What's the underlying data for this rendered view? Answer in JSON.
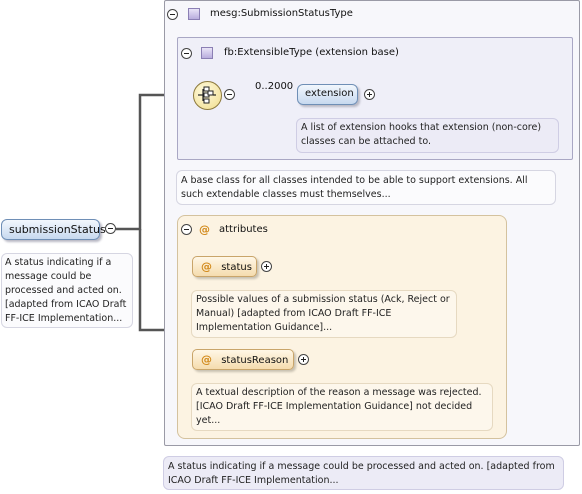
{
  "root": {
    "element_name": "submissionStatus",
    "doc": "A status indicating if a message could be processed and acted on. [adapted from ICAO Draft FF-ICE Implementation..."
  },
  "complex_type": {
    "name": "mesg:SubmissionStatusType",
    "doc": "A base class for all classes intended to be able to support extensions. All such extendable classes must themselves...",
    "bottom_doc": "A status indicating if a message could be processed and acted on. [adapted from ICAO Draft FF-ICE Implementation..."
  },
  "base_type": {
    "name": "fb:ExtensibleType (extension base)",
    "sequence_icon": "sequence-icon",
    "cardinality": "0..2000",
    "child_name": "extension",
    "child_doc": "A list of extension hooks that extension (non-core) classes can be attached to."
  },
  "attributes": {
    "title": "attributes",
    "items": [
      {
        "name": "status",
        "doc": "Possible values of a submission status (Ack, Reject or Manual) [adapted from ICAO Draft FF-ICE Implementation Guidance]..."
      },
      {
        "name": "statusReason",
        "doc": "A textual description of the reason a message was rejected. [ICAO Draft FF-ICE Implementation Guidance] not decided yet..."
      }
    ]
  },
  "colors": {
    "connector": "#555555",
    "element_fill": "#c7d9ef",
    "attribute_fill": "#f5dcae",
    "at_symbol": "#d28a1c"
  }
}
